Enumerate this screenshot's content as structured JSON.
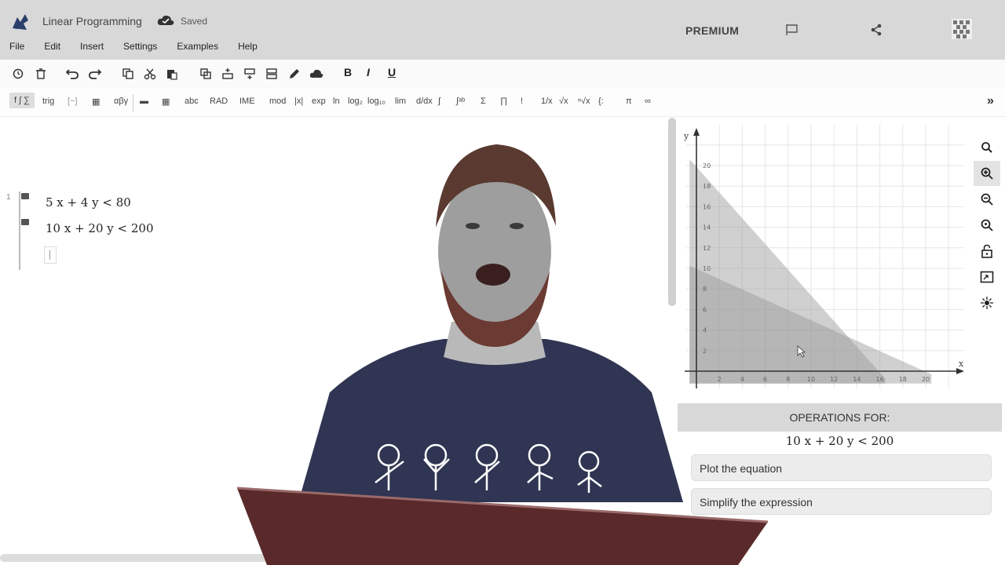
{
  "app": {
    "title": "Linear Programming",
    "save_status": "Saved",
    "premium_label": "PREMIUM",
    "menu": [
      "File",
      "Edit",
      "Insert",
      "Settings",
      "Examples",
      "Help"
    ]
  },
  "toolbar1": {
    "icons": [
      "history-icon",
      "trash-icon",
      "undo-icon",
      "redo-icon",
      "copy-icon",
      "cut-icon",
      "paste-icon",
      "duplicate-icon",
      "insert-above-icon",
      "insert-below-icon",
      "delete-row-icon",
      "pen-icon",
      "cloud-icon"
    ],
    "bold": "B",
    "italic": "I",
    "underline": "U"
  },
  "toolbar2": {
    "items": [
      "f ∫ ∑",
      "trig",
      "[~]",
      "▦",
      "αβγ",
      "▬",
      "▦",
      "abc",
      "RAD",
      "IME",
      "mod",
      "|x|",
      "exp",
      "ln",
      "log₂",
      "log₁₀",
      "lim",
      "d/dx",
      "∫",
      "∫ᵃᵇ",
      "Σ",
      "∏",
      "!",
      "1/x",
      "√x",
      "ⁿ√x",
      "{:",
      "π",
      "∞"
    ],
    "expand": "»"
  },
  "editor": {
    "lines": [
      {
        "num": "1",
        "expr": "5 x + 4 y < 80"
      },
      {
        "num": "",
        "expr": "10 x + 20 y < 200"
      }
    ]
  },
  "graph": {
    "y_label": "y",
    "x_label": "x",
    "x_ticks": [
      "2",
      "4",
      "6",
      "8",
      "10",
      "12",
      "14",
      "16",
      "18",
      "20"
    ],
    "y_ticks": [
      "2",
      "4",
      "6",
      "8",
      "10",
      "12",
      "14",
      "16",
      "18",
      "20"
    ],
    "xlim": [
      -1,
      24
    ],
    "ylim": [
      -1,
      22
    ],
    "regions": [
      {
        "name": "5x+4y<80",
        "x_intercept": 16,
        "y_intercept": 20
      },
      {
        "name": "10x+20y<200",
        "x_intercept": 20,
        "y_intercept": 10
      }
    ],
    "tools": [
      "search-icon",
      "zoom-in-icon",
      "zoom-out-icon",
      "zoom-fit-icon",
      "lock-icon",
      "resize-icon",
      "center-icon"
    ]
  },
  "operations": {
    "title": "OPERATIONS FOR:",
    "expr": "10 x + 20 y < 200",
    "actions": [
      "Plot the equation",
      "Simplify the expression"
    ]
  },
  "colors": {
    "header_bg": "#d8d8d8",
    "shirt": "#2f3552",
    "laptop": "#5a2a2a"
  }
}
